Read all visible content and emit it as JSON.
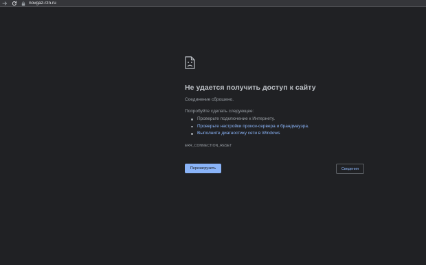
{
  "toolbar": {
    "back_icon": "arrow-right-icon",
    "reload_icon": "reload-icon",
    "lock_icon": "lock-icon",
    "url": "novgaz-rzn.ru"
  },
  "error": {
    "icon": "sad-document-icon",
    "heading": "Не удается получить доступ к сайту",
    "description": "Соединение сброшено.",
    "suggestions_title": "Попробуйте сделать следующее:",
    "suggestions": [
      {
        "text": "Проверьте подключение к Интернету.",
        "is_link": false
      },
      {
        "text": "Проверьте настройки прокси-сервера и брандмауэра.",
        "is_link": true
      },
      {
        "text": "Выполните диагностику сети в Windows",
        "is_link": true
      }
    ],
    "code": "ERR_CONNECTION_RESET"
  },
  "buttons": {
    "reload_label": "Перезагрузить",
    "details_label": "Сведения"
  },
  "colors": {
    "background": "#202124",
    "heading": "#bdc1c6",
    "text": "#9aa0a6",
    "link": "#8ab4f8",
    "primary_button": "#8ab4f8"
  }
}
